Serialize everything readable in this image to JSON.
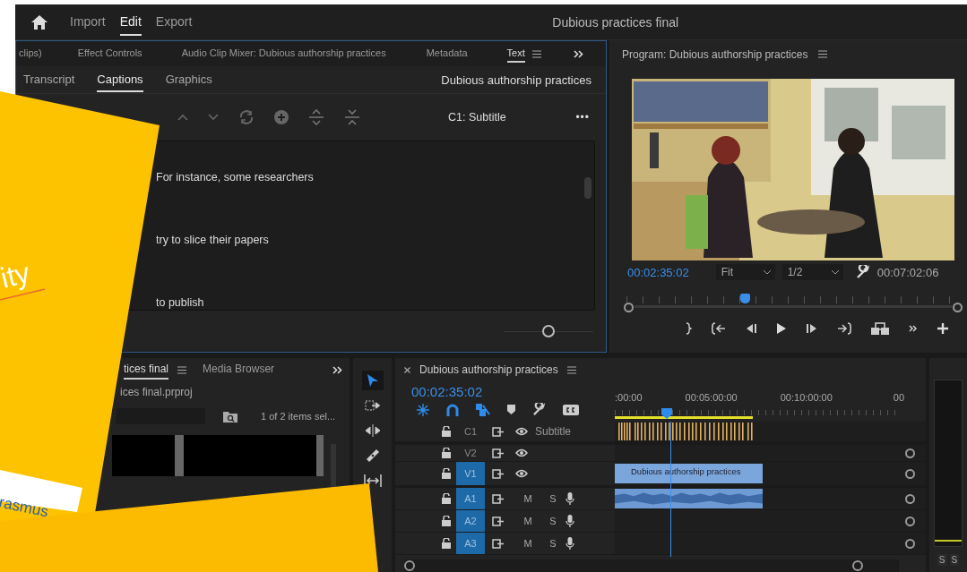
{
  "top_bar": {
    "tabs": [
      {
        "label": "Import",
        "selected": false
      },
      {
        "label": "Edit",
        "selected": true
      },
      {
        "label": "Export",
        "selected": false
      }
    ],
    "title": "Dubious practices final"
  },
  "panel_tabs": [
    {
      "label": "clips)",
      "selected": false
    },
    {
      "label": "Effect Controls",
      "selected": false
    },
    {
      "label": "Audio Clip Mixer: Dubious authorship practices",
      "selected": false
    },
    {
      "label": "Metadata",
      "selected": false
    },
    {
      "label": "Text",
      "selected": true
    }
  ],
  "caption_panel": {
    "tabs": [
      {
        "label": "Transcript",
        "selected": false
      },
      {
        "label": "Captions",
        "selected": true
      },
      {
        "label": "Graphics",
        "selected": false
      }
    ],
    "sequence": "Dubious authorship practices",
    "track": "C1: Subtitle",
    "more": "•••",
    "captions": [
      "For instance, some researchers",
      "try to slice their papers",
      "to publish"
    ],
    "zoom": {
      "level": 0.5
    }
  },
  "program_monitor": {
    "title": "Program: Dubious authorship practices",
    "timecode": "00:02:35:02",
    "fit": "Fit",
    "resolution": "1/2",
    "duration": "00:07:02:06",
    "playhead": {
      "level": 0.355
    }
  },
  "project_panel": {
    "tabs": [
      {
        "label": "tices final",
        "selected": true
      },
      {
        "label": "Media Browser",
        "selected": false
      }
    ],
    "path": "ices final.prproj",
    "selection": "1 of 2 items sel..."
  },
  "tools": [
    {
      "kind": "selection",
      "selected": true
    },
    {
      "kind": "track-select",
      "selected": false
    },
    {
      "kind": "ripple",
      "selected": false
    },
    {
      "kind": "razor",
      "selected": false
    },
    {
      "kind": "slip",
      "selected": false
    }
  ],
  "timeline": {
    "title": "Dubious authorship practices",
    "timecode": "00:02:35:02",
    "ruler": [
      ":00:00",
      "00:05:00:00",
      "00:10:00:00",
      "00"
    ],
    "playhead": {
      "level": 0.18
    },
    "tracks": [
      {
        "name": "C1",
        "kind": "caption",
        "targeted": false,
        "label": "Subtitle"
      },
      {
        "name": "V2",
        "kind": "video",
        "targeted": false
      },
      {
        "name": "V1",
        "kind": "video",
        "targeted": true,
        "clip": "Dubious authorship practices"
      },
      {
        "name": "A1",
        "kind": "audio",
        "targeted": true,
        "mute": "M",
        "solo": "S",
        "clip": true
      },
      {
        "name": "A2",
        "kind": "audio",
        "targeted": true,
        "mute": "M",
        "solo": "S"
      },
      {
        "name": "A3",
        "kind": "audio",
        "targeted": true,
        "mute": "M",
        "solo": "S"
      }
    ]
  },
  "meters": {
    "solo": [
      "S",
      "S"
    ]
  },
  "overlay": {
    "title_fragment": "ity",
    "logo_fragment": "rasmus"
  }
}
